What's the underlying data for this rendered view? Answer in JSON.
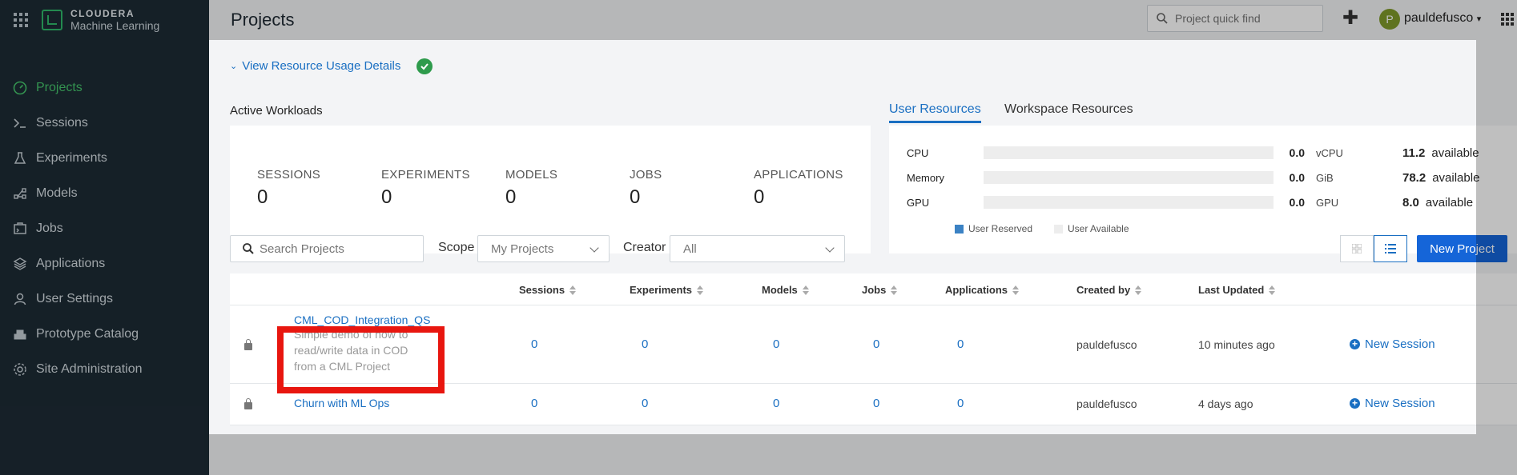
{
  "brand": {
    "line1": "CLOUDERA",
    "line2": "Machine Learning"
  },
  "nav": [
    {
      "label": "Projects",
      "icon": "gauge-icon",
      "active": true
    },
    {
      "label": "Sessions",
      "icon": "terminal-icon"
    },
    {
      "label": "Experiments",
      "icon": "flask-icon"
    },
    {
      "label": "Models",
      "icon": "model-icon"
    },
    {
      "label": "Jobs",
      "icon": "jobs-icon"
    },
    {
      "label": "Applications",
      "icon": "layers-icon"
    },
    {
      "label": "User Settings",
      "icon": "user-icon"
    },
    {
      "label": "Prototype Catalog",
      "icon": "catalog-icon"
    },
    {
      "label": "Site Administration",
      "icon": "gear-icon"
    }
  ],
  "header": {
    "title": "Projects",
    "search_placeholder": "Project quick find",
    "avatar_initial": "P",
    "username": "pauldefusco"
  },
  "usage": {
    "link_label": "View Resource Usage Details"
  },
  "workloads": {
    "title": "Active Workloads",
    "items": [
      {
        "label": "SESSIONS",
        "value": "0"
      },
      {
        "label": "EXPERIMENTS",
        "value": "0"
      },
      {
        "label": "MODELS",
        "value": "0"
      },
      {
        "label": "JOBS",
        "value": "0"
      },
      {
        "label": "APPLICATIONS",
        "value": "0"
      }
    ]
  },
  "resources": {
    "tabs": [
      "User Resources",
      "Workspace Resources"
    ],
    "rows": [
      {
        "name": "CPU",
        "value": "0.0",
        "unit": "vCPU",
        "available": "11.2",
        "available_label": "available"
      },
      {
        "name": "Memory",
        "value": "0.0",
        "unit": "GiB",
        "available": "78.2",
        "available_label": "available"
      },
      {
        "name": "GPU",
        "value": "0.0",
        "unit": "GPU",
        "available": "8.0",
        "available_label": "available"
      }
    ],
    "legend": [
      {
        "label": "User Reserved",
        "color": "#3b82c4"
      },
      {
        "label": "User Available",
        "color": "#ededed"
      }
    ]
  },
  "filters": {
    "search_placeholder": "Search Projects",
    "scope_label": "Scope",
    "scope_value": "My Projects",
    "creator_label": "Creator",
    "creator_value": "All",
    "new_project": "New Project"
  },
  "table": {
    "headers": [
      "Sessions",
      "Experiments",
      "Models",
      "Jobs",
      "Applications",
      "Created by",
      "Last Updated"
    ],
    "rows": [
      {
        "name": "CML_COD_Integration_QS",
        "desc": "Simple demo of how to read/write data in COD from a CML Project",
        "sessions": "0",
        "experiments": "0",
        "models": "0",
        "jobs": "0",
        "applications": "0",
        "created_by": "pauldefusco",
        "updated": "10 minutes ago",
        "action": "New Session"
      },
      {
        "name": "Churn with ML Ops",
        "desc": "",
        "sessions": "0",
        "experiments": "0",
        "models": "0",
        "jobs": "0",
        "applications": "0",
        "created_by": "pauldefusco",
        "updated": "4 days ago",
        "action": "New Session"
      }
    ]
  },
  "colors": {
    "accent": "#1a6fc2",
    "active_nav": "#45c46b",
    "sidebar": "#1d2b35",
    "highlight": "#e8160f"
  }
}
